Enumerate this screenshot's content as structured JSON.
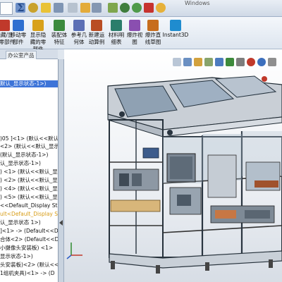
{
  "window": {
    "title": "Windows"
  },
  "ribbon": {
    "buttons": [
      {
        "label_1": "隐藏/显",
        "label_2": "示零部件",
        "icon": "eye-icon",
        "color": "#c0392b"
      },
      {
        "label_1": "移动零",
        "label_2": "部件",
        "icon": "move-component-icon",
        "color": "#2e6fd0"
      },
      {
        "label_1": "显示隐",
        "label_2": "藏的零",
        "label_3": "部件",
        "icon": "show-hidden-icon",
        "color": "#d8a11a"
      },
      {
        "label_1": "装配体",
        "label_2": "特征",
        "icon": "assembly-feature-icon",
        "color": "#3b8a3e"
      },
      {
        "label_1": "参考几",
        "label_2": "何体",
        "icon": "reference-geometry-icon",
        "color": "#5b6fb5"
      },
      {
        "label_1": "新建运",
        "label_2": "动算例",
        "icon": "motion-study-icon",
        "color": "#b94d24"
      },
      {
        "label_1": "材料明",
        "label_2": "细表",
        "icon": "bom-icon",
        "color": "#2b7d6b"
      },
      {
        "label_1": "爆炸视",
        "label_2": "图",
        "icon": "explode-icon",
        "color": "#8a4fb0"
      },
      {
        "label_1": "爆炸直",
        "label_2": "线草图",
        "icon": "explode-line-icon",
        "color": "#c76d1d"
      },
      {
        "label_1": "Instant3D",
        "label_2": "",
        "icon": "instant3d-icon",
        "color": "#1f8ccf"
      }
    ]
  },
  "tabs": {
    "office": "办公室产品"
  },
  "tree": {
    "rows": [
      {
        "text": "默认_显示状态-1>)",
        "selected": true
      },
      {
        "text": ")05 ]<1> (默认<<默认"
      },
      {
        "text": "<2> (默认<<默认_显示"
      },
      {
        "text": "(默认_显示状态-1>)"
      },
      {
        "text": "认_显示状态-1>)"
      },
      {
        "text": ") <1> (默认<<默认_显"
      },
      {
        "text": ") <2> (默认<<默认_显"
      },
      {
        "text": ") <4> (默认<<默认_显"
      },
      {
        "text": ") <5> (默认<<默认_显"
      },
      {
        "text": "<<Default_Display Sta"
      },
      {
        "text": "ult<Default_Display S",
        "yellow": true
      },
      {
        "text": "认_显示状态 1>)"
      },
      {
        "text": "]<1> -> (Default<<De"
      },
      {
        "text": "合体<2> (Default<<D"
      },
      {
        "text": "小摄像头安装板) <1>"
      },
      {
        "text": "显示状态-1>)"
      },
      {
        "text": "头安装板)<2> (默认<<"
      },
      {
        "text": "1组机夹具)<1> -> (D"
      }
    ]
  }
}
